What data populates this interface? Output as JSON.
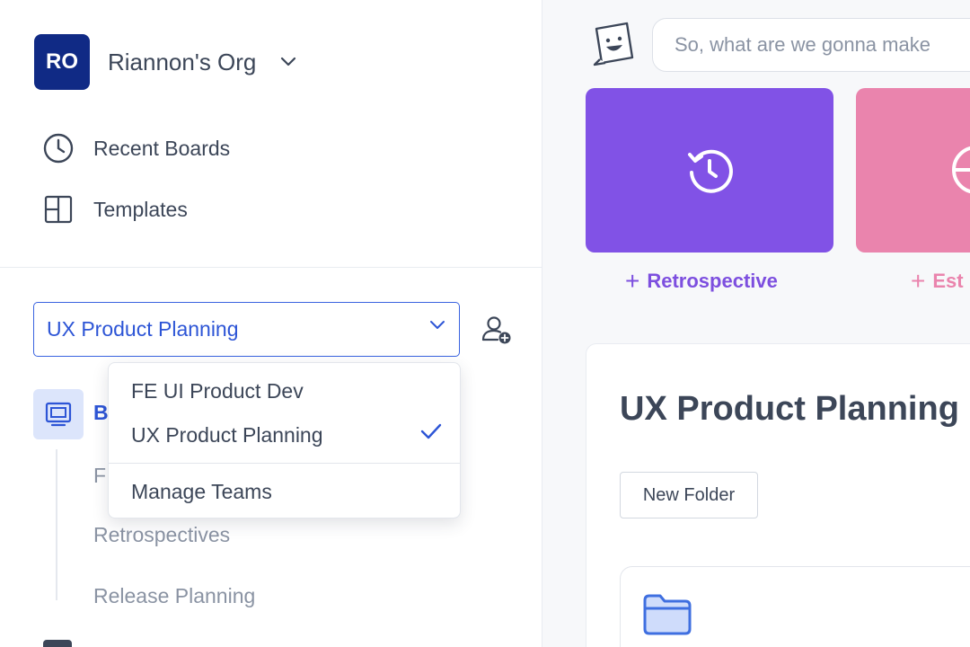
{
  "org": {
    "initials": "RO",
    "name": "Riannon's Org"
  },
  "nav": [
    {
      "label": "Recent Boards",
      "icon": "clock-icon"
    },
    {
      "label": "Templates",
      "icon": "layout-icon"
    }
  ],
  "team_select": {
    "value": "UX Product Planning"
  },
  "dropdown": {
    "options": [
      "FE UI Product Dev",
      "UX Product Planning"
    ],
    "selected": "UX Product Planning",
    "manage": "Manage Teams"
  },
  "sidebar_tree": {
    "boards_label": "B",
    "items": [
      "F",
      "Retrospectives",
      "Release Planning"
    ]
  },
  "prompt": {
    "placeholder": "So, what are we gonna make"
  },
  "tiles": [
    {
      "label": "Retrospective",
      "color": "#8152e6"
    },
    {
      "label": "Est",
      "color": "#ea84ad"
    }
  ],
  "panel": {
    "title": "UX Product Planning",
    "new_folder": "New Folder"
  }
}
